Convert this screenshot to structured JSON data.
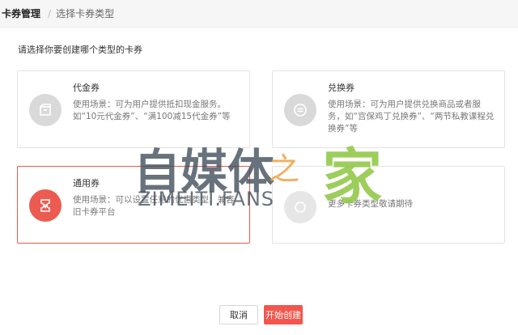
{
  "breadcrumb": {
    "root": "卡券管理",
    "separator": "/",
    "current": "选择卡券类型"
  },
  "prompt": "请选择你要创建哪个类型的卡券",
  "cards": [
    {
      "title": "代金券",
      "desc": "使用场景：可为用户提供抵扣现金服务。如“10元代金券”、“满100减15代金券”等",
      "icon": "box-icon",
      "selected": false
    },
    {
      "title": "兑换券",
      "desc": "使用场景：可为用户提供兑换商品或者服务，如“宫保鸡丁兑换券”、“两节私教课程兑换券”等",
      "icon": "exchange-icon",
      "selected": false
    },
    {
      "title": "通用券",
      "desc": "使用场景：可以设置任意的优惠类型，兼容旧卡券平台",
      "icon": "ticket-icon",
      "selected": true
    },
    {
      "title": "",
      "desc": "更多卡券类型敬请期待",
      "icon": "more-icon",
      "selected": false
    }
  ],
  "buttons": {
    "cancel": "取消",
    "start": "开始创建"
  },
  "watermark": {
    "cn": "自媒体之家",
    "en": "ZIMEITI.FANS"
  },
  "colors": {
    "accent": "#f2564c",
    "selected_border": "#e45b4f",
    "icon_gray": "#d9d9d9"
  }
}
